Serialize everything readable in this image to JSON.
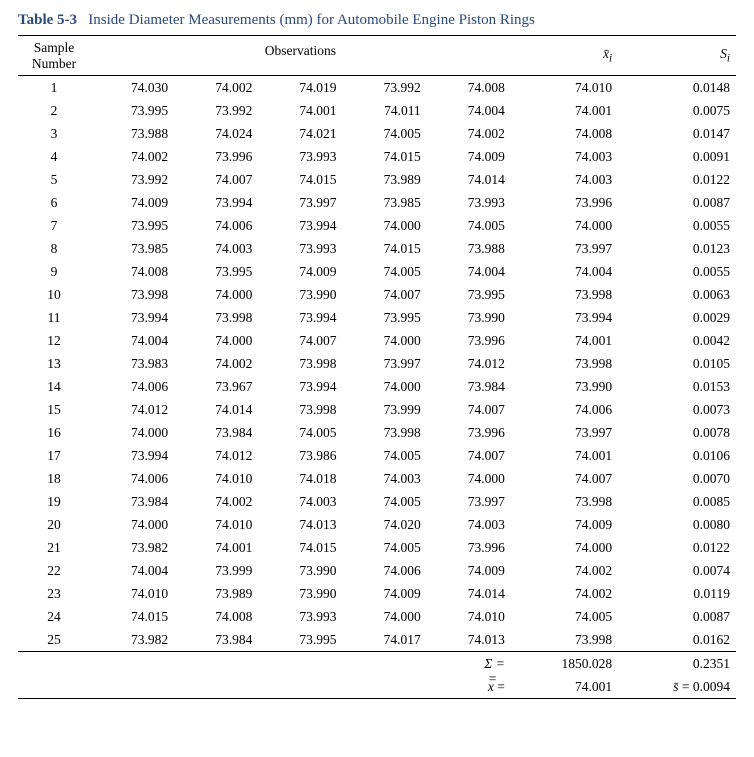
{
  "table_label": "Table 5-3",
  "table_title": "Inside Diameter Measurements (mm) for Automobile Engine Piston Rings",
  "headers": {
    "sample": "Sample\nNumber",
    "observations": "Observations",
    "xi": "x̄ᵢ",
    "si": "Sᵢ"
  },
  "rows": [
    {
      "n": "1",
      "o": [
        "74.030",
        "74.002",
        "74.019",
        "73.992",
        "74.008"
      ],
      "x": "74.010",
      "s": "0.0148"
    },
    {
      "n": "2",
      "o": [
        "73.995",
        "73.992",
        "74.001",
        "74.011",
        "74.004"
      ],
      "x": "74.001",
      "s": "0.0075"
    },
    {
      "n": "3",
      "o": [
        "73.988",
        "74.024",
        "74.021",
        "74.005",
        "74.002"
      ],
      "x": "74.008",
      "s": "0.0147"
    },
    {
      "n": "4",
      "o": [
        "74.002",
        "73.996",
        "73.993",
        "74.015",
        "74.009"
      ],
      "x": "74.003",
      "s": "0.0091"
    },
    {
      "n": "5",
      "o": [
        "73.992",
        "74.007",
        "74.015",
        "73.989",
        "74.014"
      ],
      "x": "74.003",
      "s": "0.0122"
    },
    {
      "n": "6",
      "o": [
        "74.009",
        "73.994",
        "73.997",
        "73.985",
        "73.993"
      ],
      "x": "73.996",
      "s": "0.0087"
    },
    {
      "n": "7",
      "o": [
        "73.995",
        "74.006",
        "73.994",
        "74.000",
        "74.005"
      ],
      "x": "74.000",
      "s": "0.0055"
    },
    {
      "n": "8",
      "o": [
        "73.985",
        "74.003",
        "73.993",
        "74.015",
        "73.988"
      ],
      "x": "73.997",
      "s": "0.0123"
    },
    {
      "n": "9",
      "o": [
        "74.008",
        "73.995",
        "74.009",
        "74.005",
        "74.004"
      ],
      "x": "74.004",
      "s": "0.0055"
    },
    {
      "n": "10",
      "o": [
        "73.998",
        "74.000",
        "73.990",
        "74.007",
        "73.995"
      ],
      "x": "73.998",
      "s": "0.0063"
    },
    {
      "n": "11",
      "o": [
        "73.994",
        "73.998",
        "73.994",
        "73.995",
        "73.990"
      ],
      "x": "73.994",
      "s": "0.0029"
    },
    {
      "n": "12",
      "o": [
        "74.004",
        "74.000",
        "74.007",
        "74.000",
        "73.996"
      ],
      "x": "74.001",
      "s": "0.0042"
    },
    {
      "n": "13",
      "o": [
        "73.983",
        "74.002",
        "73.998",
        "73.997",
        "74.012"
      ],
      "x": "73.998",
      "s": "0.0105"
    },
    {
      "n": "14",
      "o": [
        "74.006",
        "73.967",
        "73.994",
        "74.000",
        "73.984"
      ],
      "x": "73.990",
      "s": "0.0153"
    },
    {
      "n": "15",
      "o": [
        "74.012",
        "74.014",
        "73.998",
        "73.999",
        "74.007"
      ],
      "x": "74.006",
      "s": "0.0073"
    },
    {
      "n": "16",
      "o": [
        "74.000",
        "73.984",
        "74.005",
        "73.998",
        "73.996"
      ],
      "x": "73.997",
      "s": "0.0078"
    },
    {
      "n": "17",
      "o": [
        "73.994",
        "74.012",
        "73.986",
        "74.005",
        "74.007"
      ],
      "x": "74.001",
      "s": "0.0106"
    },
    {
      "n": "18",
      "o": [
        "74.006",
        "74.010",
        "74.018",
        "74.003",
        "74.000"
      ],
      "x": "74.007",
      "s": "0.0070"
    },
    {
      "n": "19",
      "o": [
        "73.984",
        "74.002",
        "74.003",
        "74.005",
        "73.997"
      ],
      "x": "73.998",
      "s": "0.0085"
    },
    {
      "n": "20",
      "o": [
        "74.000",
        "74.010",
        "74.013",
        "74.020",
        "74.003"
      ],
      "x": "74.009",
      "s": "0.0080"
    },
    {
      "n": "21",
      "o": [
        "73.982",
        "74.001",
        "74.015",
        "74.005",
        "73.996"
      ],
      "x": "74.000",
      "s": "0.0122"
    },
    {
      "n": "22",
      "o": [
        "74.004",
        "73.999",
        "73.990",
        "74.006",
        "74.009"
      ],
      "x": "74.002",
      "s": "0.0074"
    },
    {
      "n": "23",
      "o": [
        "74.010",
        "73.989",
        "73.990",
        "74.009",
        "74.014"
      ],
      "x": "74.002",
      "s": "0.0119"
    },
    {
      "n": "24",
      "o": [
        "74.015",
        "74.008",
        "73.993",
        "74.000",
        "74.010"
      ],
      "x": "74.005",
      "s": "0.0087"
    },
    {
      "n": "25",
      "o": [
        "73.982",
        "73.984",
        "73.995",
        "74.017",
        "74.013"
      ],
      "x": "73.998",
      "s": "0.0162"
    }
  ],
  "summary": {
    "sigma_label": "Σ =",
    "sigma_x": "1850.028",
    "sigma_s": "0.2351",
    "xbarbar_label": "x̿ =",
    "xbarbar": "74.001",
    "sbar_label": "s̄ = ",
    "sbar": "0.0094"
  },
  "chart_data": {
    "type": "table",
    "title": "Inside Diameter Measurements (mm) for Automobile Engine Piston Rings",
    "columns": [
      "Sample Number",
      "Obs1",
      "Obs2",
      "Obs3",
      "Obs4",
      "Obs5",
      "x̄ᵢ",
      "Sᵢ"
    ],
    "data": [
      [
        1,
        74.03,
        74.002,
        74.019,
        73.992,
        74.008,
        74.01,
        0.0148
      ],
      [
        2,
        73.995,
        73.992,
        74.001,
        74.011,
        74.004,
        74.001,
        0.0075
      ],
      [
        3,
        73.988,
        74.024,
        74.021,
        74.005,
        74.002,
        74.008,
        0.0147
      ],
      [
        4,
        74.002,
        73.996,
        73.993,
        74.015,
        74.009,
        74.003,
        0.0091
      ],
      [
        5,
        73.992,
        74.007,
        74.015,
        73.989,
        74.014,
        74.003,
        0.0122
      ],
      [
        6,
        74.009,
        73.994,
        73.997,
        73.985,
        73.993,
        73.996,
        0.0087
      ],
      [
        7,
        73.995,
        74.006,
        73.994,
        74.0,
        74.005,
        74.0,
        0.0055
      ],
      [
        8,
        73.985,
        74.003,
        73.993,
        74.015,
        73.988,
        73.997,
        0.0123
      ],
      [
        9,
        74.008,
        73.995,
        74.009,
        74.005,
        74.004,
        74.004,
        0.0055
      ],
      [
        10,
        73.998,
        74.0,
        73.99,
        74.007,
        73.995,
        73.998,
        0.0063
      ],
      [
        11,
        73.994,
        73.998,
        73.994,
        73.995,
        73.99,
        73.994,
        0.0029
      ],
      [
        12,
        74.004,
        74.0,
        74.007,
        74.0,
        73.996,
        74.001,
        0.0042
      ],
      [
        13,
        73.983,
        74.002,
        73.998,
        73.997,
        74.012,
        73.998,
        0.0105
      ],
      [
        14,
        74.006,
        73.967,
        73.994,
        74.0,
        73.984,
        73.99,
        0.0153
      ],
      [
        15,
        74.012,
        74.014,
        73.998,
        73.999,
        74.007,
        74.006,
        0.0073
      ],
      [
        16,
        74.0,
        73.984,
        74.005,
        73.998,
        73.996,
        73.997,
        0.0078
      ],
      [
        17,
        73.994,
        74.012,
        73.986,
        74.005,
        74.007,
        74.001,
        0.0106
      ],
      [
        18,
        74.006,
        74.01,
        74.018,
        74.003,
        74.0,
        74.007,
        0.007
      ],
      [
        19,
        73.984,
        74.002,
        74.003,
        74.005,
        73.997,
        73.998,
        0.0085
      ],
      [
        20,
        74.0,
        74.01,
        74.013,
        74.02,
        74.003,
        74.009,
        0.008
      ],
      [
        21,
        73.982,
        74.001,
        74.015,
        74.005,
        73.996,
        74.0,
        0.0122
      ],
      [
        22,
        74.004,
        73.999,
        73.99,
        74.006,
        74.009,
        74.002,
        0.0074
      ],
      [
        23,
        74.01,
        73.989,
        73.99,
        74.009,
        74.014,
        74.002,
        0.0119
      ],
      [
        24,
        74.015,
        74.008,
        73.993,
        74.0,
        74.01,
        74.005,
        0.0087
      ],
      [
        25,
        73.982,
        73.984,
        73.995,
        74.017,
        74.013,
        73.998,
        0.0162
      ]
    ],
    "summary": {
      "sum_xbar": 1850.028,
      "sum_S": 0.2351,
      "grand_mean": 74.001,
      "sbar": 0.0094
    }
  }
}
